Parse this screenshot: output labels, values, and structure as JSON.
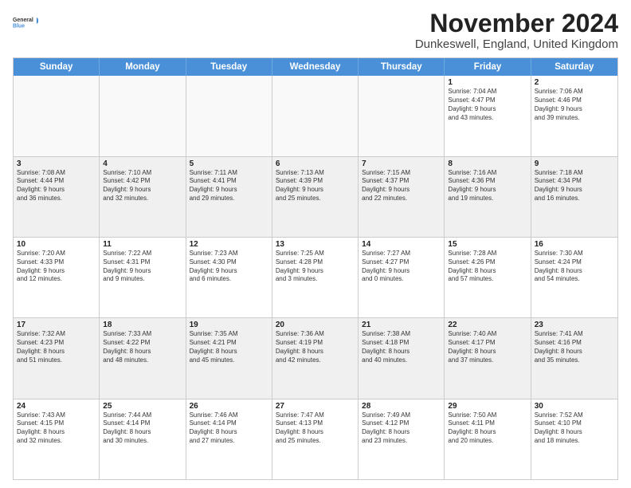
{
  "logo": {
    "general": "General",
    "blue": "Blue"
  },
  "title": "November 2024",
  "subtitle": "Dunkeswell, England, United Kingdom",
  "days_of_week": [
    "Sunday",
    "Monday",
    "Tuesday",
    "Wednesday",
    "Thursday",
    "Friday",
    "Saturday"
  ],
  "weeks": [
    [
      {
        "day": "",
        "info": "",
        "empty": true
      },
      {
        "day": "",
        "info": "",
        "empty": true
      },
      {
        "day": "",
        "info": "",
        "empty": true
      },
      {
        "day": "",
        "info": "",
        "empty": true
      },
      {
        "day": "",
        "info": "",
        "empty": true
      },
      {
        "day": "1",
        "info": "Sunrise: 7:04 AM\nSunset: 4:47 PM\nDaylight: 9 hours\nand 43 minutes."
      },
      {
        "day": "2",
        "info": "Sunrise: 7:06 AM\nSunset: 4:46 PM\nDaylight: 9 hours\nand 39 minutes."
      }
    ],
    [
      {
        "day": "3",
        "info": "Sunrise: 7:08 AM\nSunset: 4:44 PM\nDaylight: 9 hours\nand 36 minutes."
      },
      {
        "day": "4",
        "info": "Sunrise: 7:10 AM\nSunset: 4:42 PM\nDaylight: 9 hours\nand 32 minutes."
      },
      {
        "day": "5",
        "info": "Sunrise: 7:11 AM\nSunset: 4:41 PM\nDaylight: 9 hours\nand 29 minutes."
      },
      {
        "day": "6",
        "info": "Sunrise: 7:13 AM\nSunset: 4:39 PM\nDaylight: 9 hours\nand 25 minutes."
      },
      {
        "day": "7",
        "info": "Sunrise: 7:15 AM\nSunset: 4:37 PM\nDaylight: 9 hours\nand 22 minutes."
      },
      {
        "day": "8",
        "info": "Sunrise: 7:16 AM\nSunset: 4:36 PM\nDaylight: 9 hours\nand 19 minutes."
      },
      {
        "day": "9",
        "info": "Sunrise: 7:18 AM\nSunset: 4:34 PM\nDaylight: 9 hours\nand 16 minutes."
      }
    ],
    [
      {
        "day": "10",
        "info": "Sunrise: 7:20 AM\nSunset: 4:33 PM\nDaylight: 9 hours\nand 12 minutes."
      },
      {
        "day": "11",
        "info": "Sunrise: 7:22 AM\nSunset: 4:31 PM\nDaylight: 9 hours\nand 9 minutes."
      },
      {
        "day": "12",
        "info": "Sunrise: 7:23 AM\nSunset: 4:30 PM\nDaylight: 9 hours\nand 6 minutes."
      },
      {
        "day": "13",
        "info": "Sunrise: 7:25 AM\nSunset: 4:28 PM\nDaylight: 9 hours\nand 3 minutes."
      },
      {
        "day": "14",
        "info": "Sunrise: 7:27 AM\nSunset: 4:27 PM\nDaylight: 9 hours\nand 0 minutes."
      },
      {
        "day": "15",
        "info": "Sunrise: 7:28 AM\nSunset: 4:26 PM\nDaylight: 8 hours\nand 57 minutes."
      },
      {
        "day": "16",
        "info": "Sunrise: 7:30 AM\nSunset: 4:24 PM\nDaylight: 8 hours\nand 54 minutes."
      }
    ],
    [
      {
        "day": "17",
        "info": "Sunrise: 7:32 AM\nSunset: 4:23 PM\nDaylight: 8 hours\nand 51 minutes."
      },
      {
        "day": "18",
        "info": "Sunrise: 7:33 AM\nSunset: 4:22 PM\nDaylight: 8 hours\nand 48 minutes."
      },
      {
        "day": "19",
        "info": "Sunrise: 7:35 AM\nSunset: 4:21 PM\nDaylight: 8 hours\nand 45 minutes."
      },
      {
        "day": "20",
        "info": "Sunrise: 7:36 AM\nSunset: 4:19 PM\nDaylight: 8 hours\nand 42 minutes."
      },
      {
        "day": "21",
        "info": "Sunrise: 7:38 AM\nSunset: 4:18 PM\nDaylight: 8 hours\nand 40 minutes."
      },
      {
        "day": "22",
        "info": "Sunrise: 7:40 AM\nSunset: 4:17 PM\nDaylight: 8 hours\nand 37 minutes."
      },
      {
        "day": "23",
        "info": "Sunrise: 7:41 AM\nSunset: 4:16 PM\nDaylight: 8 hours\nand 35 minutes."
      }
    ],
    [
      {
        "day": "24",
        "info": "Sunrise: 7:43 AM\nSunset: 4:15 PM\nDaylight: 8 hours\nand 32 minutes."
      },
      {
        "day": "25",
        "info": "Sunrise: 7:44 AM\nSunset: 4:14 PM\nDaylight: 8 hours\nand 30 minutes."
      },
      {
        "day": "26",
        "info": "Sunrise: 7:46 AM\nSunset: 4:14 PM\nDaylight: 8 hours\nand 27 minutes."
      },
      {
        "day": "27",
        "info": "Sunrise: 7:47 AM\nSunset: 4:13 PM\nDaylight: 8 hours\nand 25 minutes."
      },
      {
        "day": "28",
        "info": "Sunrise: 7:49 AM\nSunset: 4:12 PM\nDaylight: 8 hours\nand 23 minutes."
      },
      {
        "day": "29",
        "info": "Sunrise: 7:50 AM\nSunset: 4:11 PM\nDaylight: 8 hours\nand 20 minutes."
      },
      {
        "day": "30",
        "info": "Sunrise: 7:52 AM\nSunset: 4:10 PM\nDaylight: 8 hours\nand 18 minutes."
      }
    ]
  ]
}
